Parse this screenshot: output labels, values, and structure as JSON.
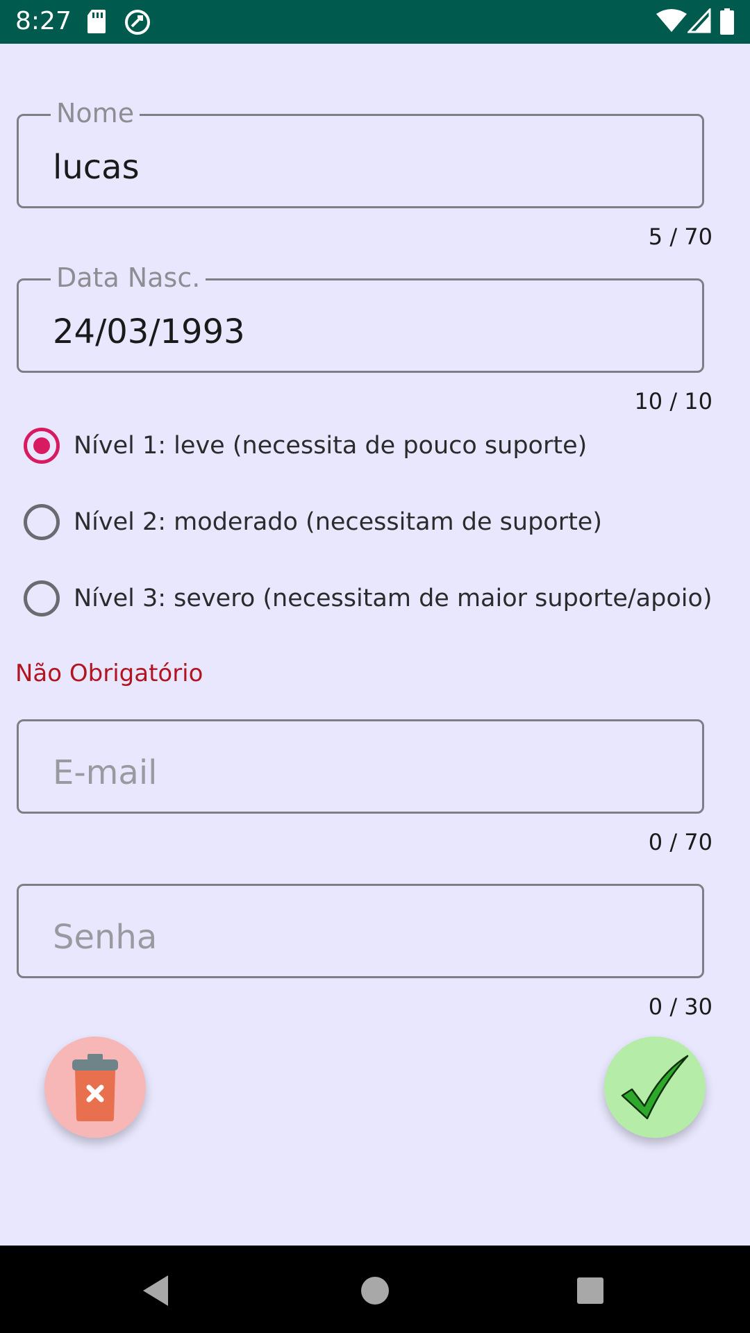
{
  "status_bar": {
    "time": "8:27",
    "left_icons": [
      "sd-card-icon",
      "sync-icon"
    ],
    "right_icons": [
      "wifi-icon",
      "cell-signal-icon",
      "battery-icon"
    ],
    "background": "#005a4e"
  },
  "form": {
    "name": {
      "label": "Nome",
      "value": "lucas",
      "counter": "5 / 70"
    },
    "birthdate": {
      "label": "Data Nasc.",
      "value": "24/03/1993",
      "counter": "10 / 10"
    },
    "levels": [
      {
        "label": "Nível 1: leve (necessita de pouco suporte)",
        "checked": true
      },
      {
        "label": "Nível 2: moderado (necessitam de suporte)",
        "checked": false
      },
      {
        "label": "Nível 3: severo (necessitam de maior suporte/apoio)",
        "checked": false
      }
    ],
    "optional_label": "Não Obrigatório",
    "email": {
      "placeholder": "E-mail",
      "counter": "0 / 70"
    },
    "password": {
      "placeholder": "Senha",
      "counter": "0 / 30"
    }
  },
  "actions": {
    "delete_icon": "trash-icon",
    "save_icon": "check-icon"
  },
  "colors": {
    "accent": "#d81b60",
    "optional_text": "#b3141f",
    "background": "#e9e7fd"
  },
  "nav_bar": {
    "icons": [
      "back-icon",
      "home-icon",
      "recents-icon"
    ]
  }
}
